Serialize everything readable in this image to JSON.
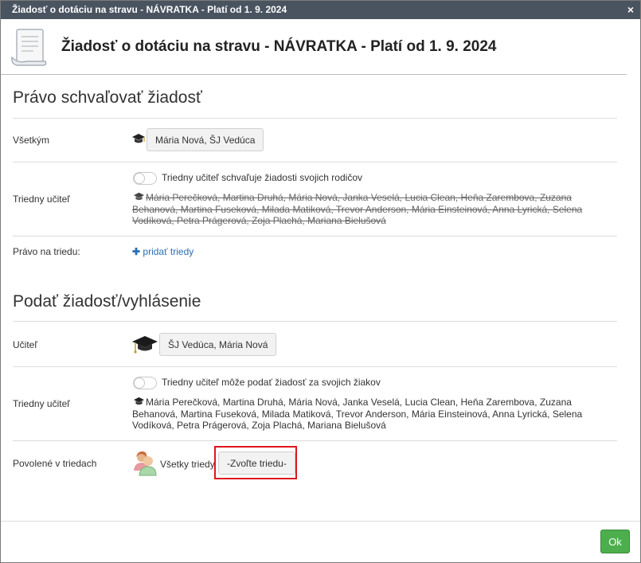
{
  "window": {
    "title": "Žiadosť o dotáciu na stravu - NÁVRATKA - Platí od 1. 9. 2024",
    "close_icon": "×"
  },
  "header": {
    "title": "Žiadosť o dotáciu na stravu - NÁVRATKA - Platí od 1. 9. 2024",
    "icon": "document-icon"
  },
  "approve_section": {
    "title": "Právo schvaľovať žiadosť",
    "everyone_label": "Všetkým",
    "everyone_value": "Mária Nová, ŠJ Vedúca",
    "class_teacher_label": "Triedny učiteľ",
    "class_teacher_toggle": "Triedny učiteľ schvaľuje žiadosti svojich rodičov",
    "class_teacher_names": "Mária Perečková, Martina Druhá, Mária Nová, Janka Veselá, Lucia Clean, Heňa Zarembova, Zuzana Behanová, Martina Fuseková, Milada Matiková, Trevor Anderson, Mária Einsteinová, Anna Lyrická, Selena Vodíková, Petra Prágerová, Zoja Plachá, Mariana Bielušová",
    "class_right_label": "Právo na triedu:",
    "add_classes_link": "pridať triedy"
  },
  "submit_section": {
    "title": "Podať žiadosť/vyhlásenie",
    "teacher_label": "Učiteľ",
    "teacher_value": "ŠJ Vedúca, Mária Nová",
    "class_teacher_label": "Triedny učiteľ",
    "class_teacher_toggle": "Triedny učiteľ môže podať žiadosť za svojich žiakov",
    "class_teacher_names": "Mária Perečková, Martina Druhá, Mária Nová, Janka Veselá, Lucia Clean, Heňa Zarembova, Zuzana Behanová, Martina Fuseková, Milada Matiková, Trevor Anderson, Mária Einsteinová, Anna Lyrická, Selena Vodíková, Petra Prágerová, Zoja Plachá, Mariana Bielušová",
    "allowed_label": "Povolené v triedach",
    "all_classes_text": "Všetky triedy",
    "choose_class_button": "-Zvoľte triedu-"
  },
  "footer": {
    "ok_label": "Ok"
  },
  "colors": {
    "titlebar": "#4a5461",
    "ok": "#4cae4c",
    "link": "#2a6db5",
    "highlight": "#e0161d"
  }
}
